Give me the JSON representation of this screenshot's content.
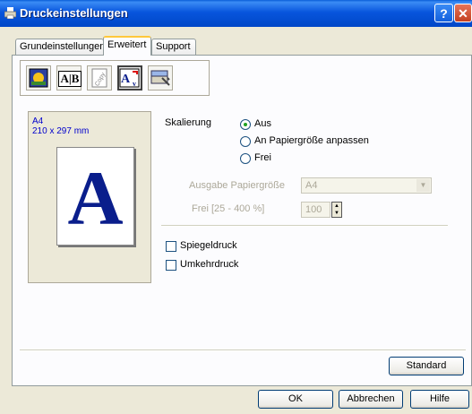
{
  "window": {
    "title": "Druckeinstellungen",
    "help_glyph": "?",
    "close_glyph": "✕"
  },
  "tabs": [
    {
      "label": "Grundeinstellungen"
    },
    {
      "label": "Erweitert"
    },
    {
      "label": "Support"
    }
  ],
  "toolbar": {
    "icons": [
      "print-quality-icon",
      "duplex-icon",
      "watermark-icon",
      "scaling-icon",
      "device-options-icon"
    ],
    "copy_watermark_text": "Copy",
    "ab_text": "A|B"
  },
  "preview": {
    "paper_name": "A4",
    "paper_dims": "210 x 297 mm",
    "letter": "A"
  },
  "scaling": {
    "label": "Skalierung",
    "options": [
      {
        "label": "Aus",
        "selected": true
      },
      {
        "label": "An Papiergröße anpassen",
        "selected": false
      },
      {
        "label": "Frei",
        "selected": false
      }
    ],
    "output_size_label": "Ausgabe Papiergröße",
    "output_size_value": "A4",
    "free_label": "Frei [25 - 400 %]",
    "free_value": "100"
  },
  "checkboxes": [
    {
      "label": "Spiegeldruck",
      "checked": false
    },
    {
      "label": "Umkehrdruck",
      "checked": false
    }
  ],
  "buttons": {
    "default": "Standard",
    "ok": "OK",
    "cancel": "Abbrechen",
    "help": "Hilfe"
  },
  "colors": {
    "titlebar": "#0855dd",
    "accent_green": "#21a121",
    "tab_highlight": "#ffc83c"
  }
}
